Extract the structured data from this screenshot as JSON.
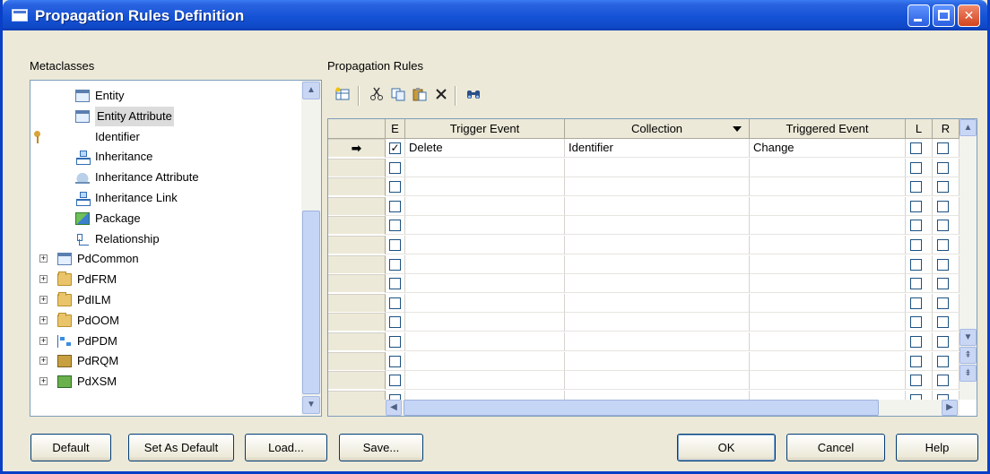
{
  "window": {
    "title": "Propagation Rules Definition"
  },
  "metaclasses": {
    "label": "Metaclasses",
    "items": [
      {
        "label": "Entity",
        "icon": "entity-icon",
        "level": 2
      },
      {
        "label": "Entity Attribute",
        "icon": "entity-attribute-icon",
        "level": 2,
        "selected": true
      },
      {
        "label": "Identifier",
        "icon": "identifier-key-icon",
        "level": 2
      },
      {
        "label": "Inheritance",
        "icon": "inheritance-icon",
        "level": 2
      },
      {
        "label": "Inheritance Attribute",
        "icon": "inheritance-attribute-icon",
        "level": 2
      },
      {
        "label": "Inheritance Link",
        "icon": "inheritance-link-icon",
        "level": 2
      },
      {
        "label": "Package",
        "icon": "package-icon",
        "level": 2
      },
      {
        "label": "Relationship",
        "icon": "relationship-icon",
        "level": 2
      },
      {
        "label": "PdCommon",
        "icon": "pdcommon-icon",
        "level": 1,
        "expander": "+"
      },
      {
        "label": "PdFRM",
        "icon": "folder-icon",
        "level": 1,
        "expander": "+"
      },
      {
        "label": "PdILM",
        "icon": "folder-icon",
        "level": 1,
        "expander": "+"
      },
      {
        "label": "PdOOM",
        "icon": "folder-icon",
        "level": 1,
        "expander": "+"
      },
      {
        "label": "PdPDM",
        "icon": "pdpdm-icon",
        "level": 1,
        "expander": "+"
      },
      {
        "label": "PdRQM",
        "icon": "pdrqm-icon",
        "level": 1,
        "expander": "+"
      },
      {
        "label": "PdXSM",
        "icon": "pdxsm-icon",
        "level": 1,
        "expander": "+"
      }
    ]
  },
  "propagation_rules": {
    "label": "Propagation Rules",
    "toolbar": [
      "add-rows-icon",
      "cut-icon",
      "copy-icon",
      "paste-icon",
      "delete-icon",
      "find-icon"
    ],
    "columns": {
      "e": "E",
      "trigger_event": "Trigger Event",
      "collection": "Collection",
      "triggered_event": "Triggered Event",
      "l": "L",
      "r": "R"
    },
    "current_row_marker": "➡",
    "rows": [
      {
        "e_checked": true,
        "trigger_event": "Delete",
        "collection": "Identifier",
        "triggered_event": "Change",
        "l_checked": false,
        "r_checked": false
      }
    ],
    "empty_row_count": 13
  },
  "buttons": {
    "default": "Default",
    "set_as_default": "Set As Default",
    "load": "Load...",
    "save": "Save...",
    "ok": "OK",
    "cancel": "Cancel",
    "help": "Help"
  }
}
